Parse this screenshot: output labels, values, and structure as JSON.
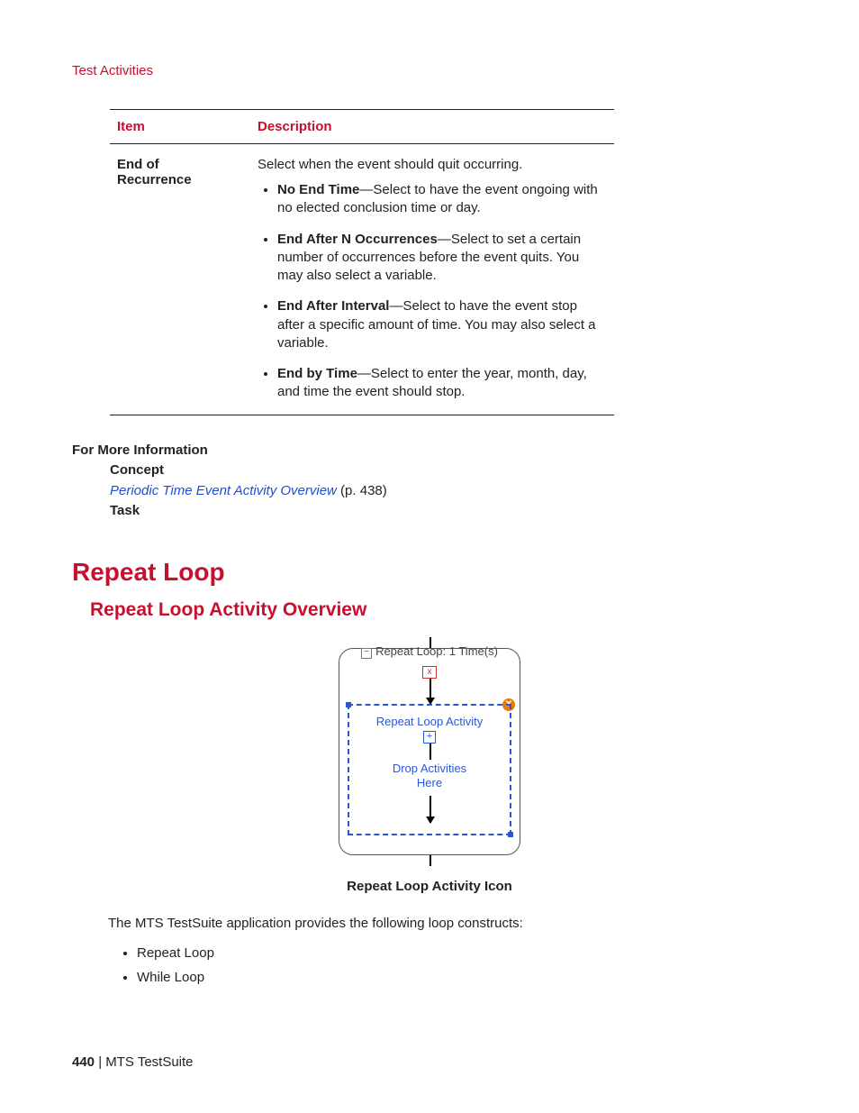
{
  "header": {
    "breadcrumb": "Test Activities"
  },
  "table": {
    "headers": {
      "item": "Item",
      "desc": "Description"
    },
    "row": {
      "item1": "End of",
      "item2": "Recurrence",
      "intro": "Select when the event should quit occurring.",
      "bullets": [
        {
          "strong": "No End Time",
          "rest": "—Select to have the event ongoing with no elected conclusion time or day."
        },
        {
          "strong": "End After N Occurrences",
          "rest": "—Select to set a certain number of occurrences before the event quits. You may also select a variable."
        },
        {
          "strong": "End After Interval",
          "rest": "—Select to have the event stop after a specific amount of time. You may also select a variable."
        },
        {
          "strong": "End by Time",
          "rest": "—Select to enter the year, month, day, and time the event should stop."
        }
      ]
    }
  },
  "moreinfo": {
    "title": "For More Information",
    "concept": "Concept",
    "link": "Periodic Time Event Activity Overview",
    "pageref": " (p. 438)",
    "task": "Task"
  },
  "section": {
    "h1": "Repeat Loop",
    "h2": "Repeat Loop Activity Overview"
  },
  "diagram": {
    "title": "Repeat Loop: 1 Time(s)",
    "inner": "Repeat Loop Activity",
    "drop1": "Drop Activities",
    "drop2": "Here",
    "caption": "Repeat Loop Activity Icon"
  },
  "body": {
    "p": "The MTS TestSuite application provides the following loop constructs:",
    "li1": "Repeat Loop",
    "li2": "While Loop"
  },
  "footer": {
    "page": "440",
    "sep": " | ",
    "product": "MTS TestSuite"
  }
}
